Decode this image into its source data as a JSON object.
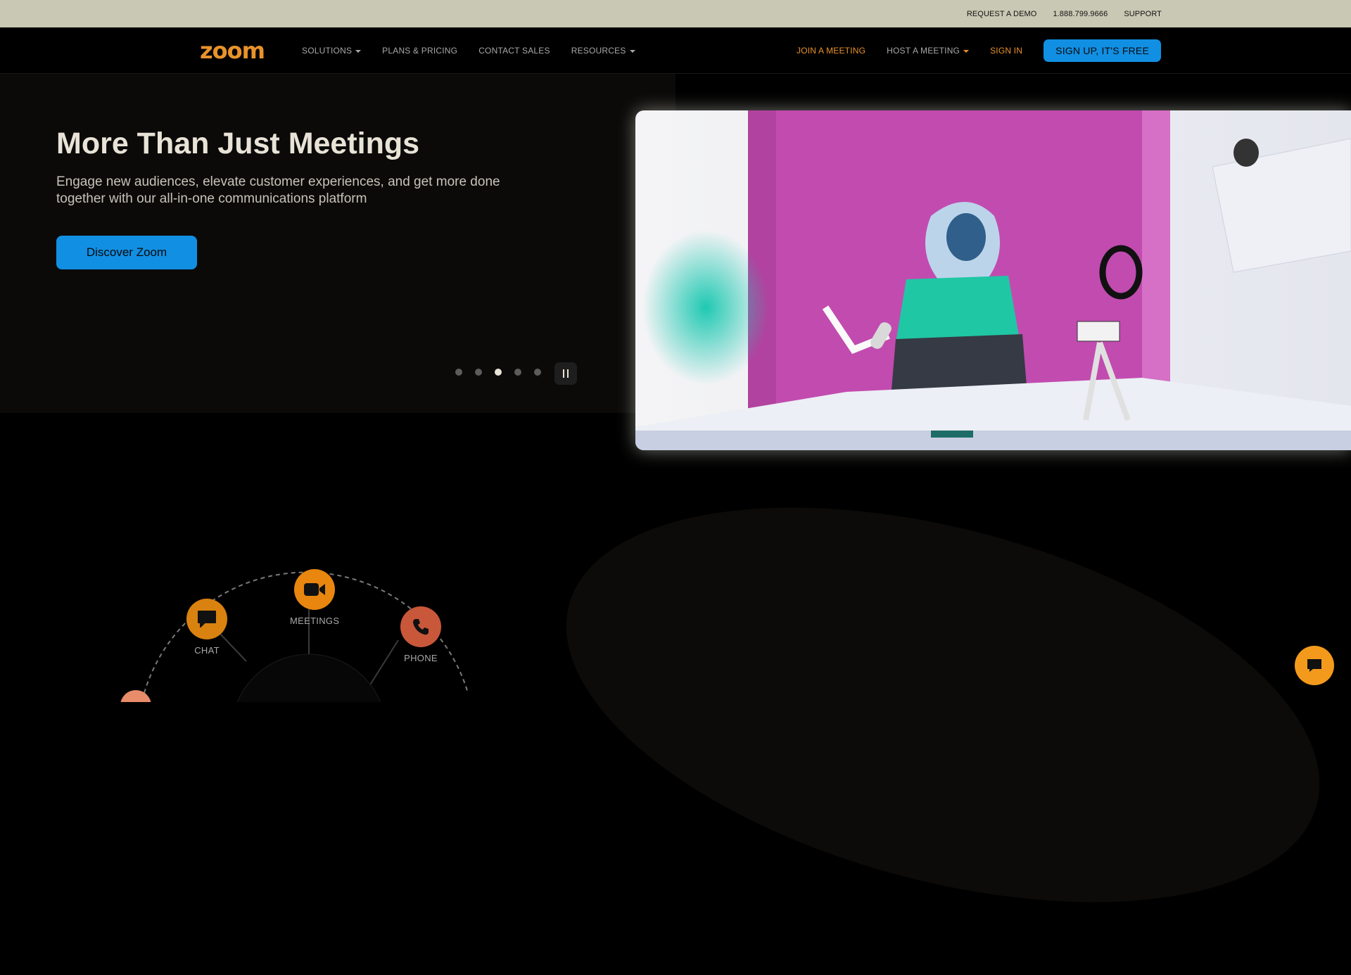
{
  "topbar": {
    "request_demo": "REQUEST A DEMO",
    "phone": "1.888.799.9666",
    "support": "SUPPORT"
  },
  "nav": {
    "logo": "zoom",
    "solutions": "SOLUTIONS",
    "plans": "PLANS & PRICING",
    "contact": "CONTACT SALES",
    "resources": "RESOURCES",
    "join": "JOIN A MEETING",
    "host": "HOST A MEETING",
    "signin": "SIGN IN",
    "signup": "SIGN UP, IT'S FREE"
  },
  "hero": {
    "title": "More Than Just Meetings",
    "subtitle": "Engage new audiences, elevate customer experiences, and get more done together with our all-in-one communications platform",
    "cta": "Discover Zoom",
    "slides": 5,
    "active_slide": 3
  },
  "products": {
    "chat": "CHAT",
    "meetings": "MEETINGS",
    "phone": "PHONE"
  },
  "colors": {
    "accent_orange": "#e8922b",
    "accent_blue": "#118fe3",
    "phone_red": "#c9573a"
  }
}
